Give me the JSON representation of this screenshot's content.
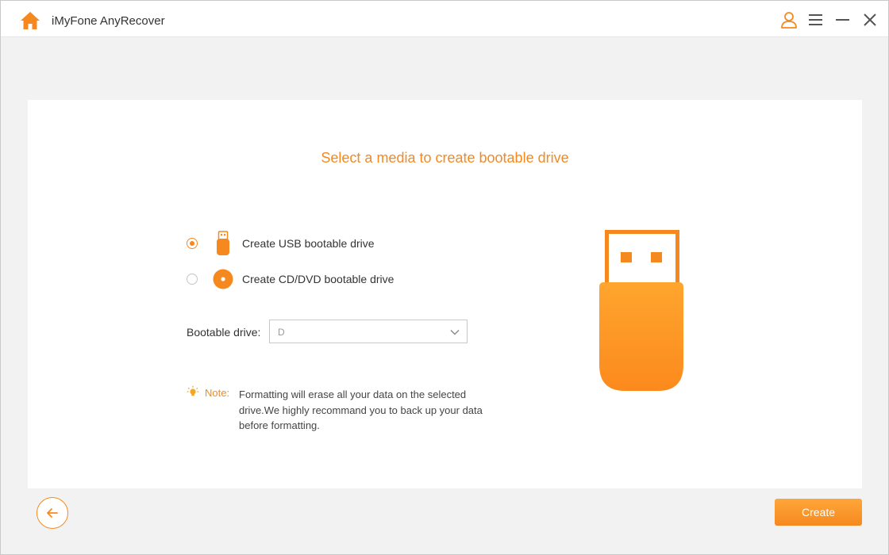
{
  "app": {
    "title": "iMyFone AnyRecover"
  },
  "titlebar": {
    "icons": [
      "home-icon",
      "user-icon",
      "menu-icon",
      "minimize-icon",
      "close-icon"
    ]
  },
  "main": {
    "heading": "Select a media to create bootable drive",
    "options": [
      {
        "label": "Create USB bootable drive",
        "selected": true,
        "icon": "usb-drive-icon"
      },
      {
        "label": "Create CD/DVD bootable drive",
        "selected": false,
        "icon": "disc-icon"
      }
    ],
    "bootable_drive": {
      "label": "Bootable drive:",
      "value": "D",
      "icon": "chevron-down-icon"
    },
    "note": {
      "title": "Note:",
      "text": "Formatting will erase all your data on the selected drive.We highly recommand you to back up your data before formatting.",
      "icon": "lightbulb-icon"
    },
    "illustration": "usb-drive-illustration"
  },
  "footer": {
    "back_icon": "arrow-left-icon",
    "create_label": "Create"
  },
  "colors": {
    "accent": "#f5891f",
    "accent_light": "#ffa63a",
    "background": "#f2f2f2",
    "card": "#ffffff"
  }
}
